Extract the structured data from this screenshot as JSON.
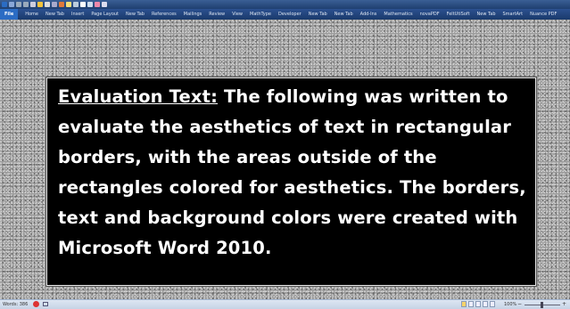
{
  "ribbon": {
    "tabs": [
      "File",
      "Home",
      "New Tab",
      "Insert",
      "Page Layout",
      "New Tab",
      "References",
      "Mailings",
      "Review",
      "View",
      "MathType",
      "Developer",
      "New Tab",
      "New Tab",
      "Add-Ins",
      "Mathematics",
      "novaPDF",
      "FeltUtiSoft",
      "New Tab",
      "SmartArt",
      "Nuance PDF"
    ]
  },
  "document": {
    "label": "Evaluation Text:",
    "body": "The following was written to evaluate the aesthetics of text in rectangular borders, with the areas outside of the rectangles colored for aesthetics.  The borders, text and background colors were created with Microsoft Word 2010."
  },
  "status_bar": {
    "word_count": "Words: 386",
    "zoom": "100%",
    "zoom_minus": "−",
    "zoom_plus": "+"
  },
  "colors": {
    "ribbon": "#2c5190",
    "frame_background": "#000000",
    "text": "#ffffff",
    "page_texture": "#9d9d9d"
  }
}
